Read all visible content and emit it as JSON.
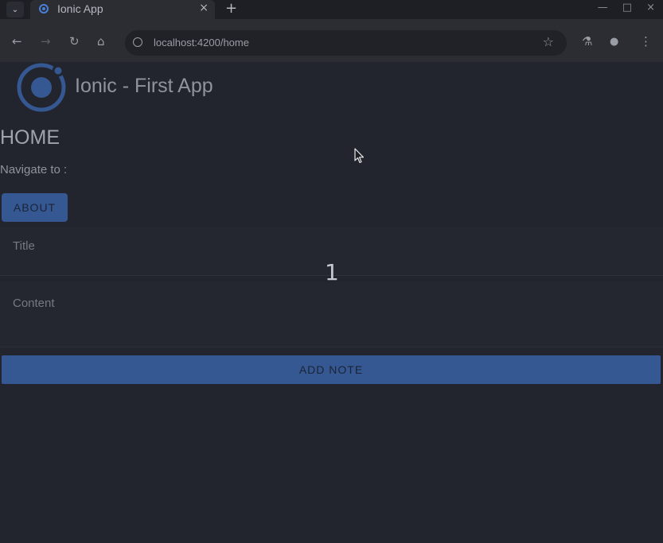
{
  "browser": {
    "tab_title": "Ionic App",
    "url": "localhost:4200/home",
    "close_glyph": "×",
    "new_tab_glyph": "+",
    "menu_glyph": "⌄",
    "minimize_glyph": "—",
    "maximize_glyph": "□",
    "window_close_glyph": "×",
    "back_glyph": "←",
    "forward_glyph": "→",
    "reload_glyph": "↻",
    "home_glyph": "⌂",
    "star_glyph": "☆",
    "labs_glyph": "⚗",
    "profile_glyph": "●",
    "more_glyph": "⋮"
  },
  "app": {
    "title": "Ionic - First App",
    "page_heading": "HOME",
    "navigate_label": "Navigate to :",
    "about_button": "ABOUT",
    "title_field_label": "Title",
    "content_field_label": "Content",
    "badge": "1",
    "add_note_button": "ADD NOTE"
  },
  "colors": {
    "accent": "#355792",
    "page_bg": "#22252e",
    "logo": "#355792"
  },
  "icons": [
    "tab-menu-icon",
    "ionic-favicon-icon",
    "back-icon",
    "forward-icon",
    "reload-icon",
    "home-icon",
    "site-info-icon",
    "bookmark-star-icon",
    "labs-icon",
    "profile-icon",
    "more-menu-icon",
    "ionic-logo-icon",
    "mouse-cursor-icon"
  ]
}
